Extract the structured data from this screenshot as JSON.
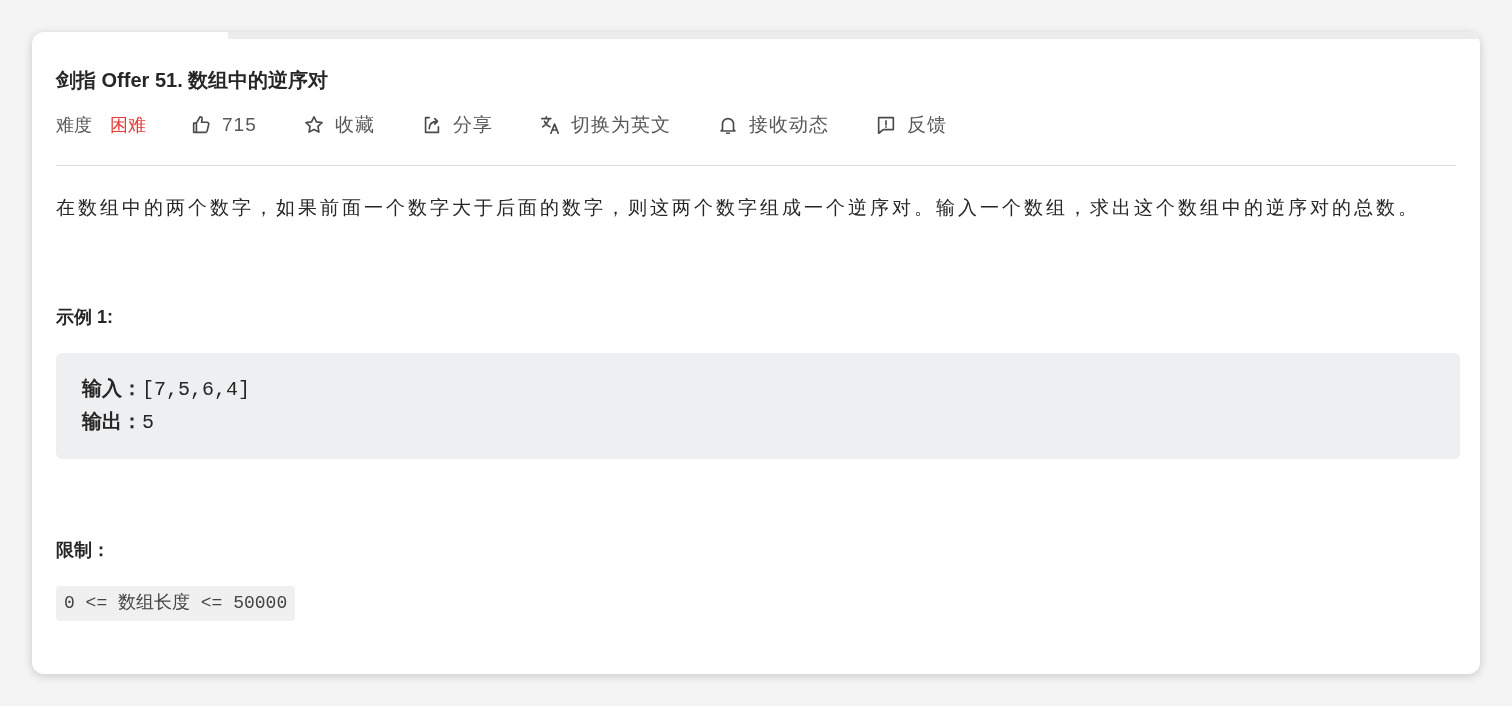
{
  "problem": {
    "title": "剑指 Offer 51. 数组中的逆序对",
    "difficulty": {
      "label": "难度",
      "value": "困难",
      "color": "#e53935"
    },
    "actions": [
      {
        "kind": "like",
        "label": "715"
      },
      {
        "kind": "star",
        "label": "收藏"
      },
      {
        "kind": "share",
        "label": "分享"
      },
      {
        "kind": "translate",
        "label": "切换为英文"
      },
      {
        "kind": "bell",
        "label": "接收动态"
      },
      {
        "kind": "feedback",
        "label": "反馈"
      }
    ],
    "description": "在数组中的两个数字，如果前面一个数字大于后面的数字，则这两个数字组成一个逆序对。输入一个数组，求出这个数组中的逆序对的总数。",
    "example": {
      "heading": "示例 1:",
      "lines": [
        "**输入：**[7,5,6,4]",
        "**输出：**5"
      ]
    },
    "limits": {
      "heading": "限制：",
      "code": "0 <= 数组长度 <= 50000"
    }
  }
}
